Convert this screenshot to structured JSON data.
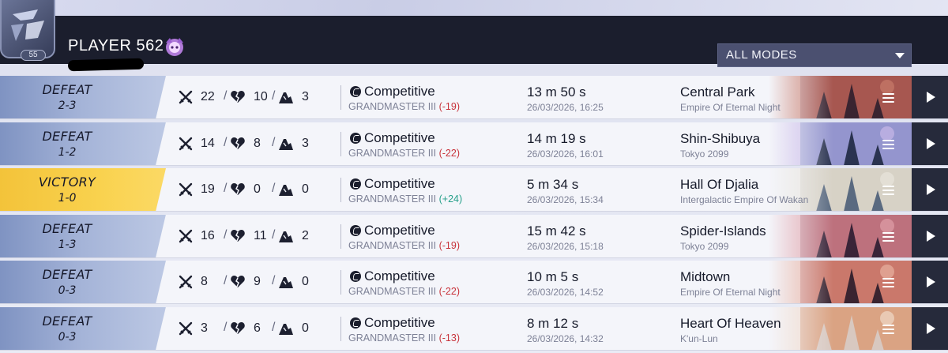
{
  "header": {
    "player_name": "PLAYER 562",
    "level": "55",
    "mode_filter": "ALL MODES"
  },
  "colors": {
    "header_bg": "#1b1e2d",
    "defeat": "#8fa1cd",
    "victory": "#f6c73f",
    "rank_loss": "#c8333b",
    "rank_gain": "#26a08a",
    "play_button": "#262a3b"
  },
  "matches": [
    {
      "result": "DEFEAT",
      "score": "2-3",
      "kills": "22",
      "deaths": "10",
      "assists": "3",
      "mode": "Competitive",
      "rank": "GRANDMASTER III",
      "rank_change": "(-19)",
      "duration": "13 m 50 s",
      "datetime": "26/03/2026, 16:25",
      "map": "Central Park",
      "region": "Empire Of Eternal Night"
    },
    {
      "result": "DEFEAT",
      "score": "1-2",
      "kills": "14",
      "deaths": "8",
      "assists": "3",
      "mode": "Competitive",
      "rank": "GRANDMASTER III",
      "rank_change": "(-22)",
      "duration": "14 m 19 s",
      "datetime": "26/03/2026, 16:01",
      "map": "Shin-Shibuya",
      "region": "Tokyo 2099"
    },
    {
      "result": "VICTORY",
      "score": "1-0",
      "kills": "19",
      "deaths": "0",
      "assists": "0",
      "mode": "Competitive",
      "rank": "GRANDMASTER III",
      "rank_change": "(+24)",
      "duration": "5 m 34 s",
      "datetime": "26/03/2026, 15:34",
      "map": "Hall Of Djalia",
      "region": "Intergalactic Empire Of Wakan"
    },
    {
      "result": "DEFEAT",
      "score": "1-3",
      "kills": "16",
      "deaths": "11",
      "assists": "2",
      "mode": "Competitive",
      "rank": "GRANDMASTER III",
      "rank_change": "(-19)",
      "duration": "15 m 42 s",
      "datetime": "26/03/2026, 15:18",
      "map": "Spider-Islands",
      "region": "Tokyo 2099"
    },
    {
      "result": "DEFEAT",
      "score": "0-3",
      "kills": "8",
      "deaths": "9",
      "assists": "0",
      "mode": "Competitive",
      "rank": "GRANDMASTER III",
      "rank_change": "(-22)",
      "duration": "10 m 5 s",
      "datetime": "26/03/2026, 14:52",
      "map": "Midtown",
      "region": "Empire Of Eternal Night"
    },
    {
      "result": "DEFEAT",
      "score": "0-3",
      "kills": "3",
      "deaths": "6",
      "assists": "0",
      "mode": "Competitive",
      "rank": "GRANDMASTER III",
      "rank_change": "(-13)",
      "duration": "8 m 12 s",
      "datetime": "26/03/2026, 14:32",
      "map": "Heart Of Heaven",
      "region": "K'un-Lun"
    }
  ]
}
